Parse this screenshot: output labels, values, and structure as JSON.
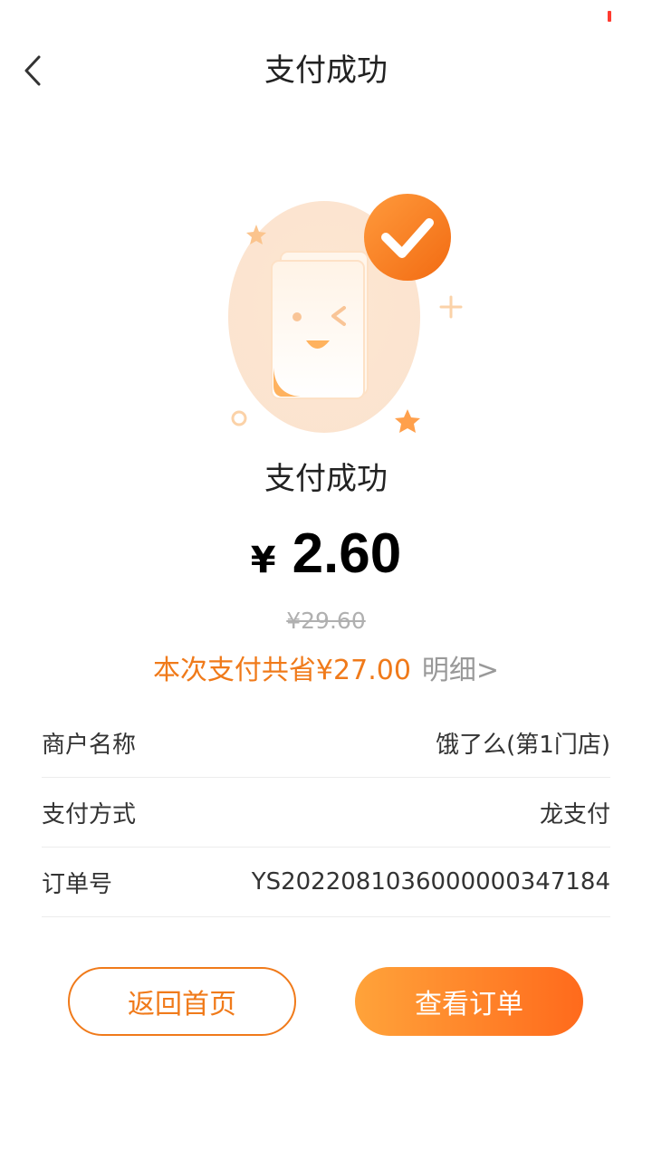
{
  "header": {
    "title": "支付成功",
    "back_icon": "chevron-left-icon"
  },
  "result": {
    "status_text": "支付成功",
    "currency_symbol": "¥",
    "amount": "2.60",
    "original_amount": "¥29.60",
    "saving_text": "本次支付共省¥27.00",
    "detail_link": "明细>"
  },
  "info": {
    "rows": [
      {
        "label": "商户名称",
        "value": "饿了么(第1门店)"
      },
      {
        "label": "支付方式",
        "value": "龙支付"
      },
      {
        "label": "订单号",
        "value": "YS2022081036000000347184"
      }
    ]
  },
  "buttons": {
    "home_label": "返回首页",
    "order_label": "查看订单"
  },
  "colors": {
    "accent": "#f07a1a",
    "gradient_start": "#ffa33a",
    "gradient_end": "#ff6a1c",
    "status_dot": "#ff3b30"
  }
}
